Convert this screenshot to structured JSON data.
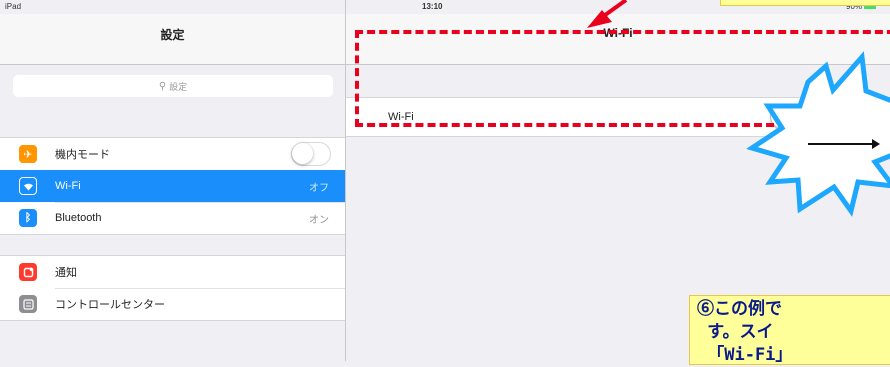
{
  "status_bar": {
    "carrier": "iPad",
    "time": "13:10",
    "battery": "90%"
  },
  "settings": {
    "title": "設定",
    "search_placeholder": "設定",
    "items": [
      {
        "label": "機内モード",
        "value": "",
        "icon": "airplane-icon",
        "color": "#ff9500"
      },
      {
        "label": "Wi-Fi",
        "value": "オフ",
        "icon": "wifi-icon",
        "color": "#1a8ffb"
      },
      {
        "label": "Bluetooth",
        "value": "オン",
        "icon": "bluetooth-icon",
        "color": "#1a8ffb"
      },
      {
        "label": "通知",
        "value": "",
        "icon": "notifications-icon",
        "color": "#ff3b30"
      },
      {
        "label": "コントロールセンター",
        "value": "",
        "icon": "control-center-icon",
        "color": "#8e8e93"
      }
    ]
  },
  "detail": {
    "title": "Wi-Fi",
    "wifi_label": "Wi-Fi",
    "wifi_on": false
  },
  "annotation": {
    "note_text": "⑥この例で\n す。スイ\n 「Wi-Fi」",
    "highlight_color": "#e8001d",
    "note_bg": "#ffff99",
    "starburst_color": "#1ea7ff"
  }
}
